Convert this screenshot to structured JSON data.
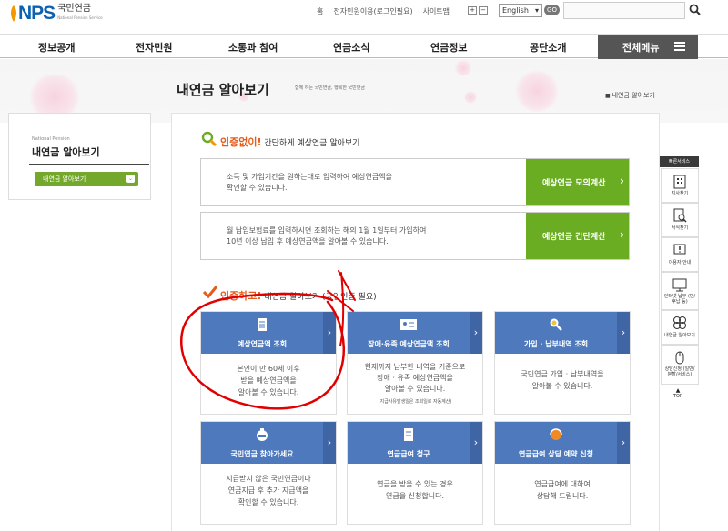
{
  "header": {
    "logo_text": "NPS",
    "logo_kr": "국민연금",
    "logo_sub": "National Pension Service",
    "util_links": [
      "홈",
      "전자민원이용(로그인필요)",
      "사이트맵"
    ],
    "font_size_buttons": [
      "+",
      "−"
    ],
    "language": "English",
    "go_button": "GO",
    "search_placeholder": ""
  },
  "gnb": {
    "items": [
      "정보공개",
      "전자민원",
      "소통과 참여",
      "연금소식",
      "연금정보",
      "공단소개"
    ],
    "all_menu": "전체메뉴"
  },
  "page": {
    "title": "내연금 알아보기",
    "subtitle": "함께 하는 국민연금, 행복한 국민연금",
    "breadcrumb": "내연금 알아보기"
  },
  "lnb": {
    "en_title": "National Pension",
    "title": "내연금 알아보기",
    "selected": "내연금 알아보기",
    "chevron": "⌄"
  },
  "section1": {
    "highlight": "인증없이!",
    "rest": " 간단하게 예상연금 알아보기",
    "rows": [
      {
        "text1": "소득 및 가입기간을 원하는대로 입력하여 예상연금액을",
        "text2": "확인할 수 있습니다.",
        "button": "예상연금 모의계산"
      },
      {
        "text1": "월 납입보험료를 입력하시면 조회하는 해의 1월 1일부터 가입하여",
        "text2": "10년 이상 납입 후 예상연금액을 알아볼 수 있습니다.",
        "button": "예상연금 간단계산"
      }
    ]
  },
  "section2": {
    "highlight": "인증하고!",
    "rest": " 내연금 알아보기 (공인인증 필요)",
    "cards": [
      {
        "label": "예상연금액 조회",
        "desc": [
          "본인이 만 60세 이후",
          "받을 예상연금액을",
          "알아볼 수 있습니다."
        ],
        "note": ""
      },
      {
        "label": "장애·유족 예상연금액 조회",
        "desc": [
          "현재까지 납부한 내역을 기준으로",
          "장애 · 유족 예상연금액을",
          "알아볼 수 있습니다."
        ],
        "note": "(지급사유발생일은 조회일로 자동계산)"
      },
      {
        "label": "가입 · 납부내역 조회",
        "desc": [
          "국민연금 가입 · 납부내역을",
          "알아볼 수 있습니다."
        ],
        "note": ""
      },
      {
        "label": "국민연금 찾아가세요",
        "desc": [
          "지급받지 않은 국민연금이나",
          "연금지급 후 추가 지급액을",
          "확인할 수 있습니다."
        ],
        "note": ""
      },
      {
        "label": "연금급여 청구",
        "desc": [
          "연금을 받을 수 있는 경우",
          "연금을 신청합니다."
        ],
        "note": ""
      },
      {
        "label": "연금급여 상담 예약 신청",
        "desc": [
          "연금급여에 대하여",
          "상담해 드립니다."
        ],
        "note": ""
      }
    ]
  },
  "quick": {
    "title": "빠른서비스",
    "items": [
      "지사찾기",
      "서식찾기",
      "이용자 안내",
      "인터넷 납부 (반/후납 등)",
      "내연금 알아보기",
      "상담신청 (일반/분할/서비스)"
    ],
    "top": "TOP"
  },
  "colors": {
    "green": "#6aad22",
    "blue": "#4e79bd",
    "orange": "#e85a17",
    "annotation": "#e00000"
  }
}
